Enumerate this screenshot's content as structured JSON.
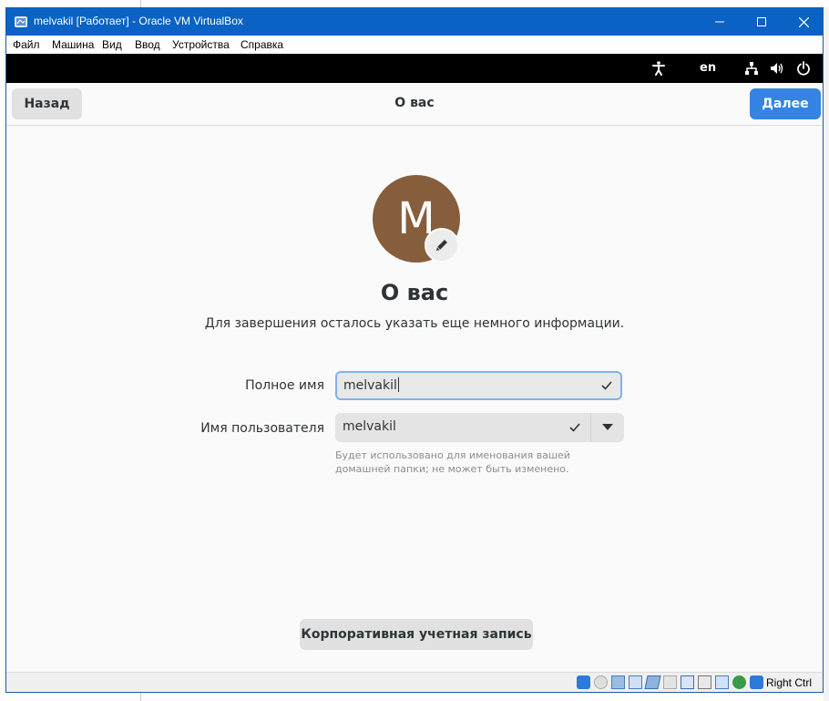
{
  "window": {
    "title": "melvakil [Работает] - Oracle VM VirtualBox"
  },
  "menubar": {
    "items": [
      "Файл",
      "Машина",
      "Вид",
      "Ввод",
      "Устройства",
      "Справка"
    ]
  },
  "gnome_topbar": {
    "language": "en"
  },
  "header": {
    "back_label": "Назад",
    "title": "О вас",
    "next_label": "Далее"
  },
  "avatar": {
    "initial": "M",
    "color": "#865e3c"
  },
  "content": {
    "heading": "О вас",
    "subtitle": "Для завершения осталось указать еще немного информации."
  },
  "form": {
    "full_name_label": "Полное имя",
    "full_name_value": "melvakil",
    "username_label": "Имя пользователя",
    "username_value": "melvakil",
    "username_hint": "Будет использовано для именования вашей домашней папки; не может быть изменено."
  },
  "enterprise_button": "Корпоративная учетная запись",
  "statusbar": {
    "host_key": "Right Ctrl"
  },
  "colors": {
    "titlebar": "#0962c4",
    "accent": "#3584e4",
    "focus_ring": "#7eb1ee"
  }
}
